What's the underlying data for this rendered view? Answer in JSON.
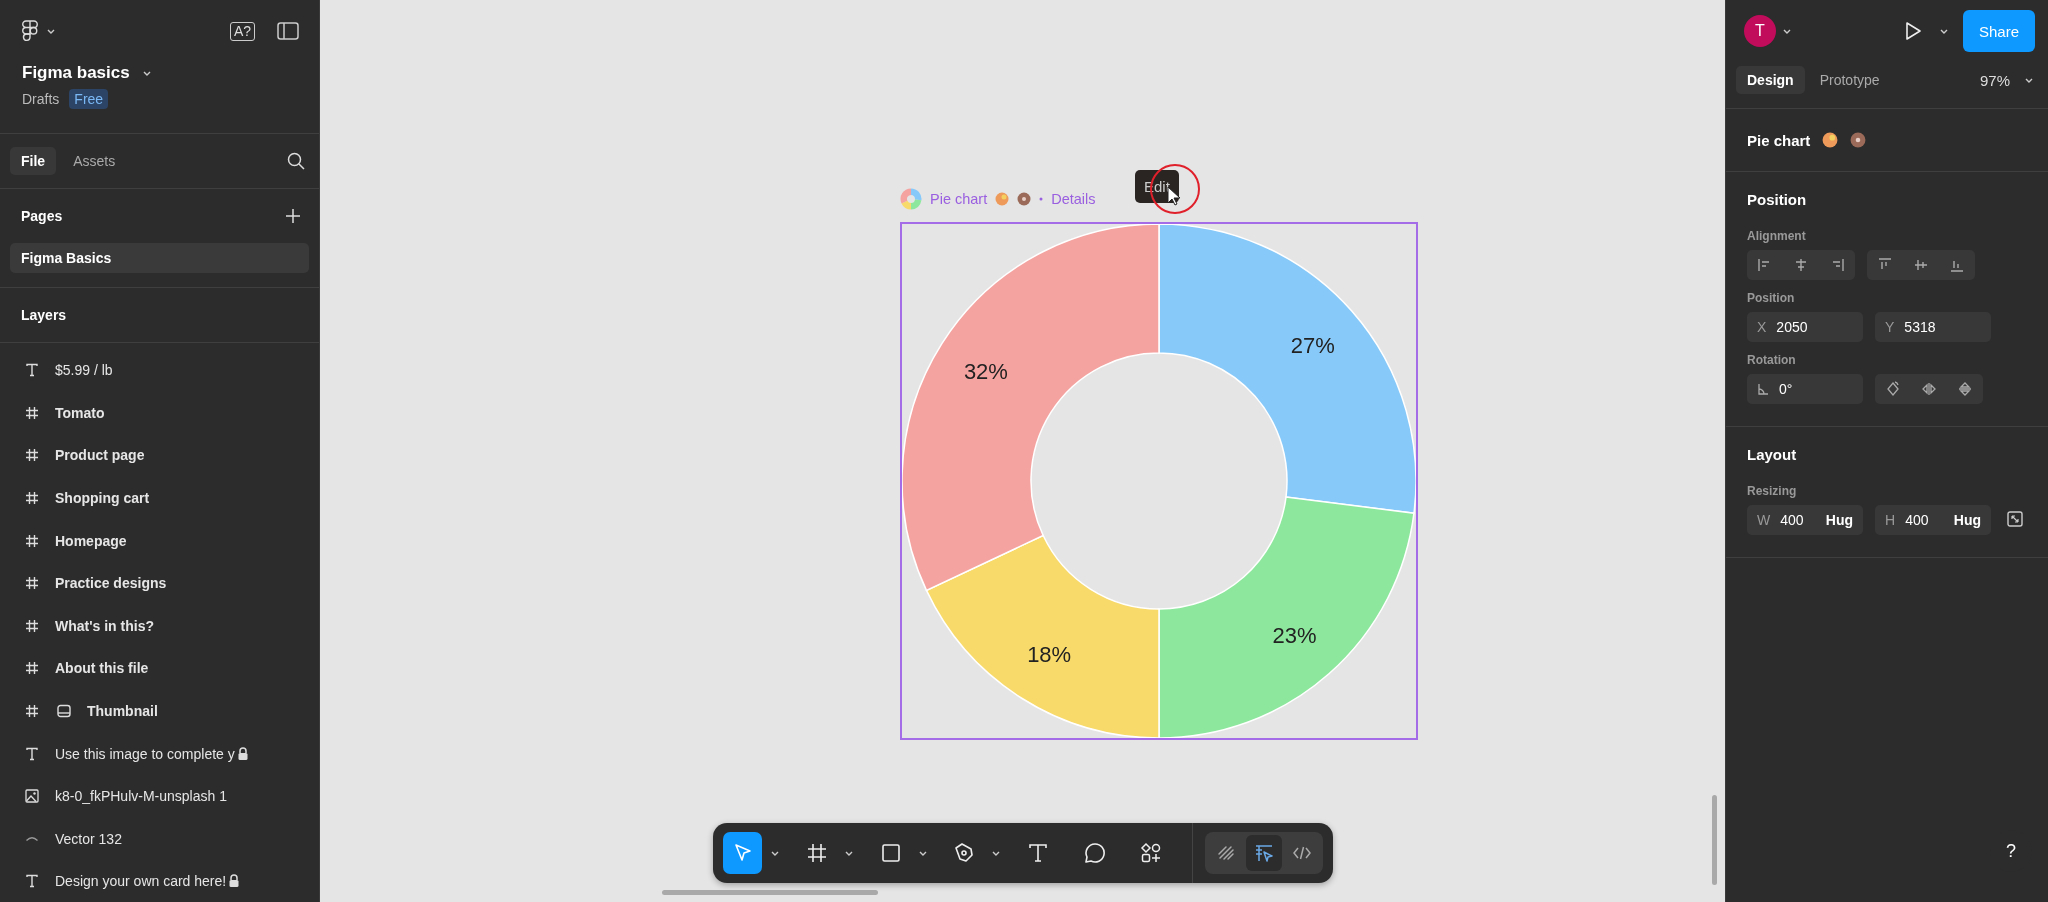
{
  "left_panel": {
    "help_key": "A?",
    "file_name": "Figma basics",
    "location": "Drafts",
    "plan_badge": "Free",
    "tabs": [
      {
        "label": "File",
        "selected": true
      },
      {
        "label": "Assets",
        "selected": false
      }
    ],
    "pages_heading": "Pages",
    "pages": [
      {
        "label": "Figma Basics",
        "selected": true
      }
    ],
    "layers_heading": "Layers",
    "layers": [
      {
        "kind": "text",
        "label": "$5.99 / lb",
        "locked": false,
        "inner_icon": false
      },
      {
        "kind": "frame",
        "label": "Tomato",
        "locked": false,
        "inner_icon": false
      },
      {
        "kind": "frame",
        "label": "Product page",
        "locked": false,
        "inner_icon": false
      },
      {
        "kind": "frame",
        "label": "Shopping cart",
        "locked": false,
        "inner_icon": false
      },
      {
        "kind": "frame",
        "label": "Homepage",
        "locked": false,
        "inner_icon": false
      },
      {
        "kind": "frame",
        "label": "Practice designs",
        "locked": false,
        "inner_icon": false
      },
      {
        "kind": "frame",
        "label": "What's in this?",
        "locked": false,
        "inner_icon": false
      },
      {
        "kind": "frame",
        "label": "About this file",
        "locked": false,
        "inner_icon": false
      },
      {
        "kind": "frame",
        "label": "Thumbnail",
        "locked": false,
        "inner_icon": true
      },
      {
        "kind": "text",
        "label": "Use this image to complete y",
        "locked": true,
        "inner_icon": false
      },
      {
        "kind": "image",
        "label": "k8-0_fkPHulv-M-unsplash 1",
        "locked": false,
        "inner_icon": false
      },
      {
        "kind": "vector",
        "label": "Vector 132",
        "locked": false,
        "inner_icon": false
      },
      {
        "kind": "text",
        "label": "Design your own card here!",
        "locked": true,
        "inner_icon": false
      }
    ]
  },
  "canvas": {
    "selection_label": "Pie chart",
    "details_link": "Details",
    "tooltip": "Edit",
    "chart_data": {
      "type": "donut",
      "values": [
        27,
        23,
        18,
        32
      ],
      "colors": [
        "#87cafa",
        "#8de89e",
        "#f8da6b",
        "#f5a3a0"
      ],
      "value_labels": [
        "27%",
        "23%",
        "18%",
        "32%"
      ]
    },
    "tools": [
      {
        "kind": "move",
        "selected": true,
        "has_menu": true
      },
      {
        "kind": "frame",
        "selected": false,
        "has_menu": true
      },
      {
        "kind": "shape",
        "selected": false,
        "has_menu": true
      },
      {
        "kind": "pen",
        "selected": false,
        "has_menu": true
      },
      {
        "kind": "text",
        "selected": false,
        "has_menu": false
      },
      {
        "kind": "comment",
        "selected": false,
        "has_menu": false
      },
      {
        "kind": "actions",
        "selected": false,
        "has_menu": false
      }
    ],
    "modes": [
      {
        "kind": "draw",
        "selected": false
      },
      {
        "kind": "design",
        "selected": true
      },
      {
        "kind": "dev",
        "selected": false
      }
    ],
    "help": "?"
  },
  "right_panel": {
    "avatar": "T",
    "share": "Share",
    "tabs": [
      {
        "label": "Design",
        "selected": true
      },
      {
        "label": "Prototype",
        "selected": false
      }
    ],
    "zoom": "97%",
    "selection_title": "Pie chart",
    "position_heading": "Position",
    "alignment_label": "Alignment",
    "position_label": "Position",
    "x": {
      "label": "X",
      "value": "2050"
    },
    "y": {
      "label": "Y",
      "value": "5318"
    },
    "rotation_label": "Rotation",
    "rotation": "0°",
    "layout_heading": "Layout",
    "resizing_label": "Resizing",
    "width": {
      "label": "W",
      "value": "400",
      "mode": "Hug"
    },
    "height": {
      "label": "H",
      "value": "400",
      "mode": "Hug"
    }
  }
}
